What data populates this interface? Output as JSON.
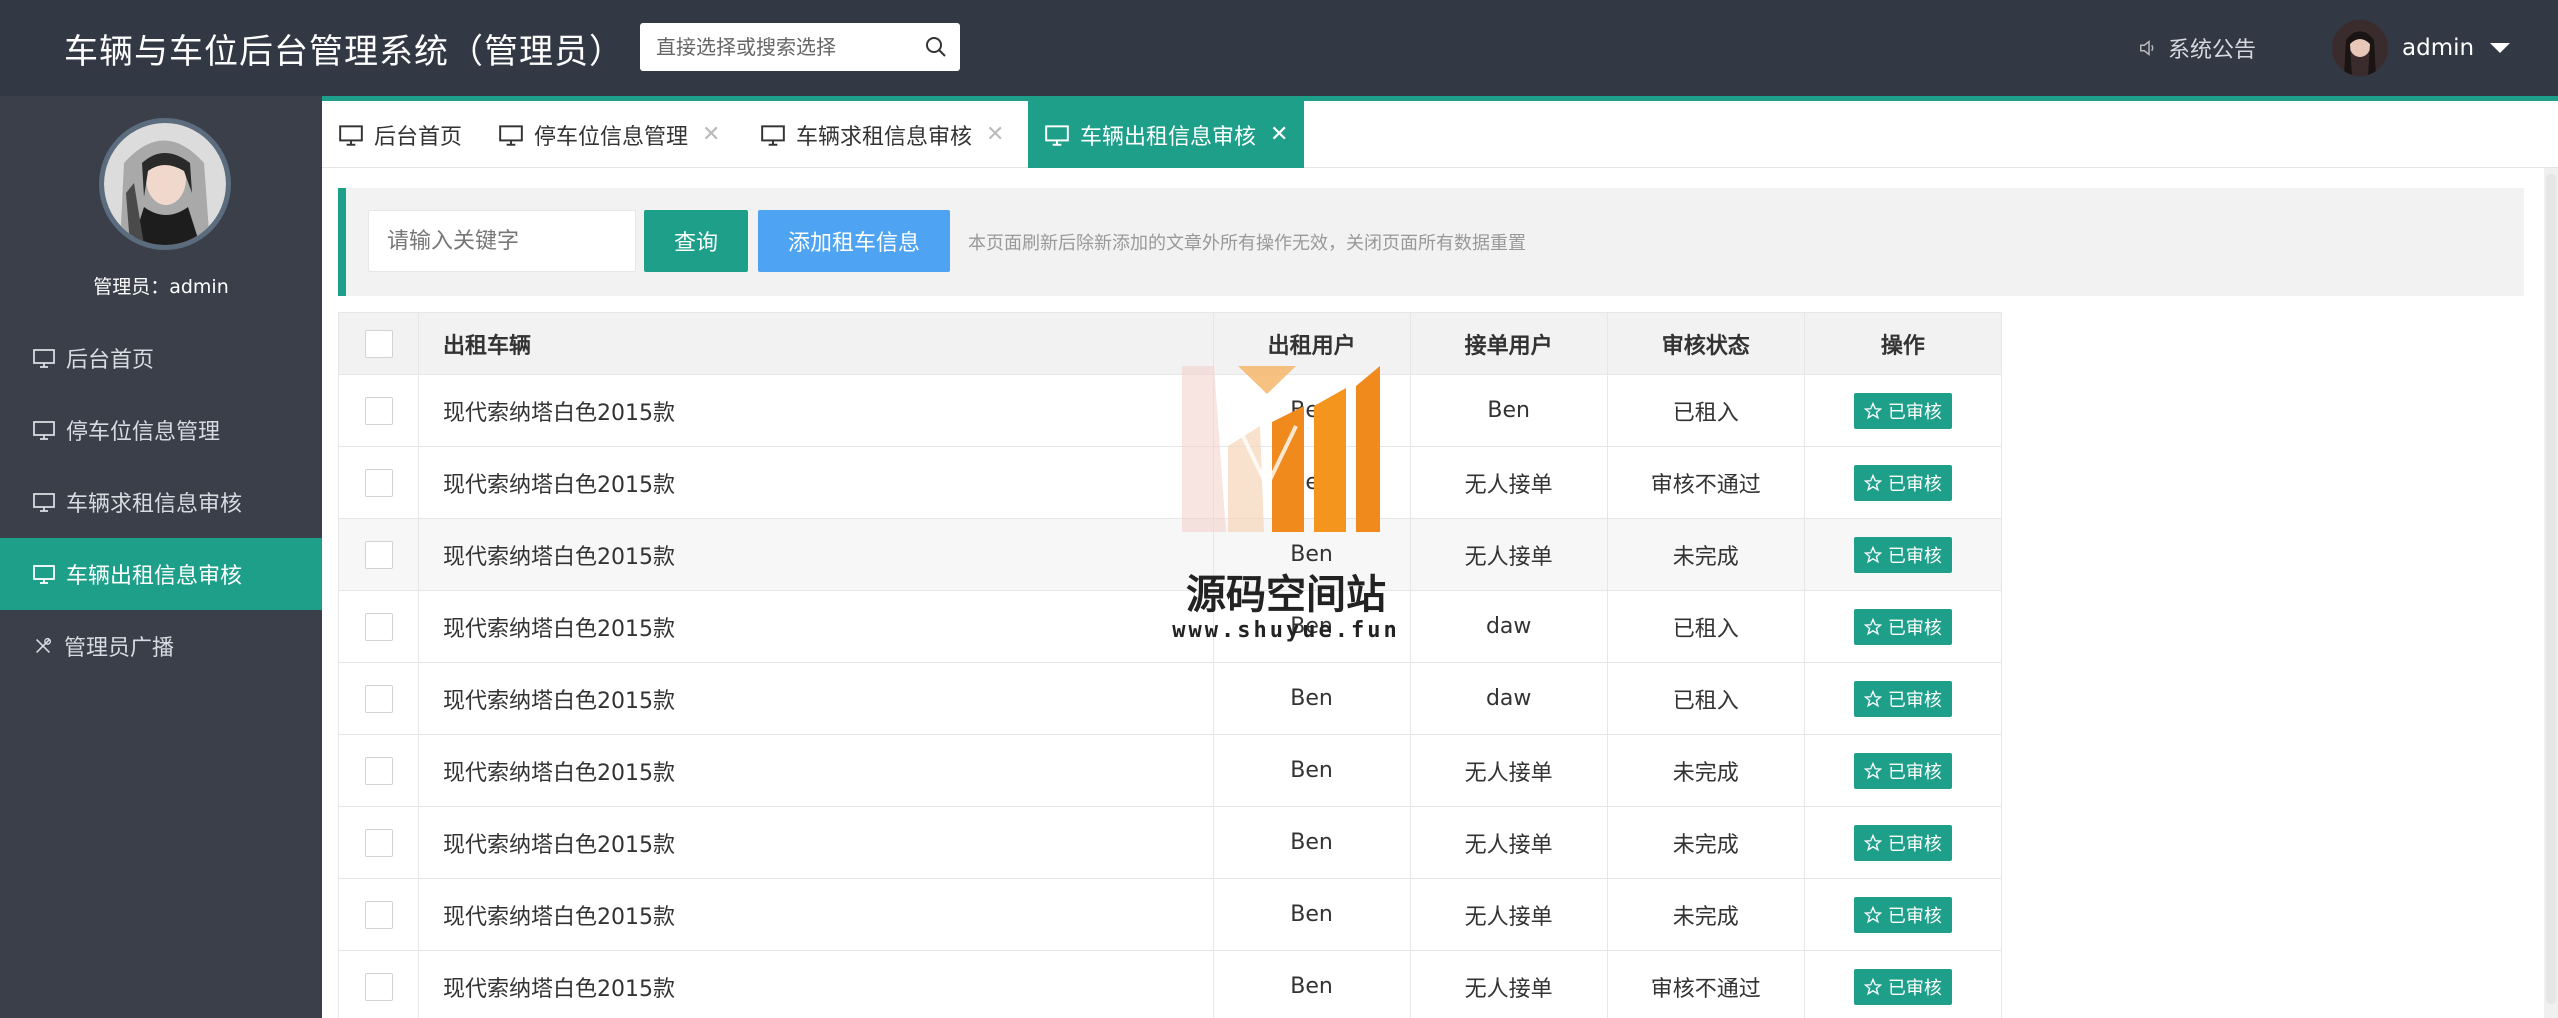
{
  "header": {
    "title": "车辆与车位后台管理系统（管理员）",
    "search_placeholder": "直接选择或搜索选择",
    "notice_label": "系统公告",
    "username": "admin"
  },
  "sidebar": {
    "admin_label": "管理员：admin",
    "items": [
      {
        "label": "后台首页",
        "icon": "monitor-icon"
      },
      {
        "label": "停车位信息管理",
        "icon": "monitor-icon"
      },
      {
        "label": "车辆求租信息审核",
        "icon": "monitor-icon"
      },
      {
        "label": "车辆出租信息审核",
        "icon": "monitor-icon",
        "active": true
      },
      {
        "label": "管理员广播",
        "icon": "tools-icon"
      }
    ]
  },
  "tabs": [
    {
      "label": "后台首页",
      "closable": false
    },
    {
      "label": "停车位信息管理",
      "closable": true
    },
    {
      "label": "车辆求租信息审核",
      "closable": true
    },
    {
      "label": "车辆出租信息审核",
      "closable": true,
      "active": true
    }
  ],
  "tab_close_glyph": "✕",
  "toolbar": {
    "keyword_placeholder": "请输入关键字",
    "query_label": "查询",
    "add_label": "添加租车信息",
    "tip": "本页面刷新后除新添加的文章外所有操作无效，关闭页面所有数据重置"
  },
  "table": {
    "columns": [
      "出租车辆",
      "出租用户",
      "接单用户",
      "审核状态",
      "操作"
    ],
    "rows": [
      {
        "car": "现代索纳塔白色2015款",
        "renter": "Ben",
        "taker": "Ben",
        "status": "已租入",
        "action": "已审核"
      },
      {
        "car": "现代索纳塔白色2015款",
        "renter": "Ben",
        "taker": "无人接单",
        "status": "审核不通过",
        "action": "已审核"
      },
      {
        "car": "现代索纳塔白色2015款",
        "renter": "Ben",
        "taker": "无人接单",
        "status": "未完成",
        "action": "已审核"
      },
      {
        "car": "现代索纳塔白色2015款",
        "renter": "Ben",
        "taker": "daw",
        "status": "已租入",
        "action": "已审核"
      },
      {
        "car": "现代索纳塔白色2015款",
        "renter": "Ben",
        "taker": "daw",
        "status": "已租入",
        "action": "已审核"
      },
      {
        "car": "现代索纳塔白色2015款",
        "renter": "Ben",
        "taker": "无人接单",
        "status": "未完成",
        "action": "已审核"
      },
      {
        "car": "现代索纳塔白色2015款",
        "renter": "Ben",
        "taker": "无人接单",
        "status": "未完成",
        "action": "已审核"
      },
      {
        "car": "现代索纳塔白色2015款",
        "renter": "Ben",
        "taker": "无人接单",
        "status": "未完成",
        "action": "已审核"
      },
      {
        "car": "现代索纳塔白色2015款",
        "renter": "Ben",
        "taker": "无人接单",
        "status": "审核不通过",
        "action": "已审核"
      }
    ]
  },
  "watermark": {
    "title": "源码空间站",
    "url": "www.shuyue.fun"
  },
  "colors": {
    "header_bg": "#323844",
    "sidebar_bg": "#3b3f4a",
    "accent": "#1e9f8a",
    "add_button": "#4ea4f3"
  }
}
